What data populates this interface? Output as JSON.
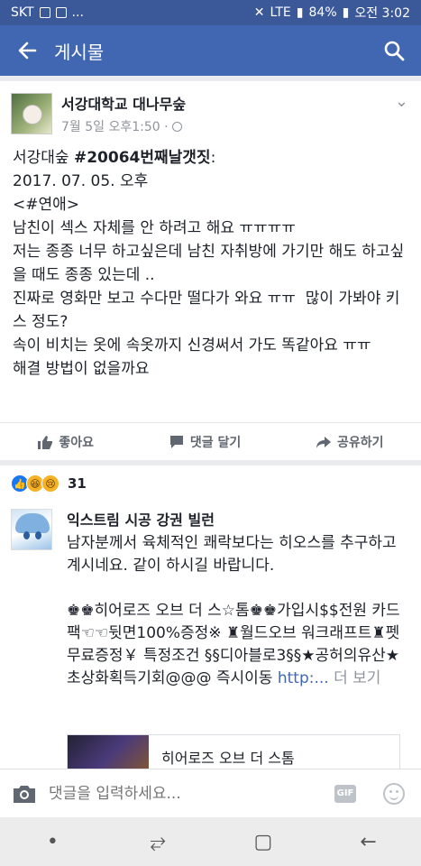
{
  "status_bar": {
    "carrier": "SKT",
    "battery": "84%",
    "time": "오전 3:02",
    "network": "LTE"
  },
  "app_bar": {
    "title": "게시물"
  },
  "post": {
    "page_name": "서강대학교 대나무숲",
    "time": "7월 5일 오후1:50 · ",
    "intro_prefix": "서강대숲 ",
    "intro_hashtag": "#20064번째날갯짓",
    "intro_suffix": ":",
    "body": "\n2017. 07. 05. 오후\n<#연애>\n남친이 섹스 자체를 안 하려고 해요 ㅠㅠㅠㅠ\n저는 종종 너무 하고싶은데 남친 자취방에 가기만 해도 하고싶을 때도 종종 있는데 ..\n진짜로 영화만 보고 수다만 떨다가 와요 ㅠㅠ  많이 가봐야 키스 정도?\n속이 비치는 옷에 속옷까지 신경써서 가도 똑같아요 ㅠㅠ\n해결 방법이 없을까요",
    "actions": {
      "like": "좋아요",
      "comment": "댓글 달기",
      "share": "공유하기"
    }
  },
  "reactions": {
    "count": "31"
  },
  "comment": {
    "author": "익스트림 시공 강권 빌런",
    "text": "남자분께서 육체적인 쾌락보다는 히오스를 추구하고 계시네요. 같이 하시길 바랍니다.\n\n♚♚히어로즈 오브 더 스☆톰♚♚가입시$$전원 카드팩☜☜뒷면100%증정※ ♜월드오브 워크래프트♜펫 무료증정￥ 특정조건 §§디아블로3§§★공허의유산★초상화획득기회@@@ 즉시이동 ",
    "link_text": "http:...",
    "more": " 더 보기",
    "preview_title": "히어로즈 오브 더 스톰"
  },
  "composer": {
    "placeholder": "댓글을 입력하세요...",
    "gif": "GIF"
  }
}
